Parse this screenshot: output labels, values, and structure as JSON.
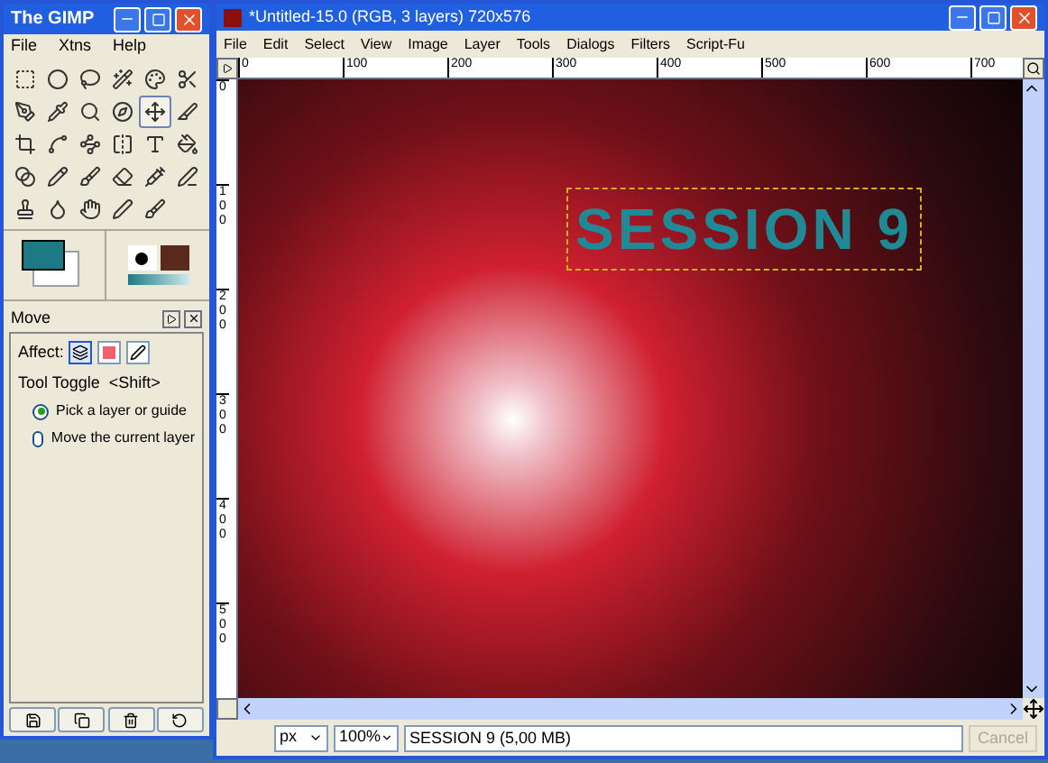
{
  "toolbox": {
    "title": "The GIMP",
    "menu": [
      "File",
      "Xtns",
      "Help"
    ],
    "tools": [
      {
        "selected": false
      },
      {
        "selected": false
      },
      {
        "selected": false
      },
      {
        "selected": false
      },
      {
        "selected": false
      },
      {
        "selected": false
      },
      {
        "selected": false
      },
      {
        "selected": false
      },
      {
        "selected": false
      },
      {
        "selected": false
      },
      {
        "selected": true
      },
      {
        "selected": false
      },
      {
        "selected": false
      },
      {
        "selected": false
      },
      {
        "selected": false
      },
      {
        "selected": false
      },
      {
        "selected": false
      },
      {
        "selected": false
      },
      {
        "selected": false
      },
      {
        "selected": false
      },
      {
        "selected": false
      },
      {
        "selected": false
      },
      {
        "selected": false
      },
      {
        "selected": false
      },
      {
        "selected": false
      },
      {
        "selected": false
      },
      {
        "selected": false
      },
      {
        "selected": false
      },
      {
        "selected": false
      }
    ],
    "options": {
      "title": "Move",
      "affect_label": "Affect:",
      "affect": [
        {
          "selected": true
        },
        {
          "selected": false
        },
        {
          "selected": false
        }
      ],
      "toggle_label": "Tool Toggle  <Shift>",
      "radios": [
        {
          "label": "Pick a layer or guide",
          "selected": true
        },
        {
          "label": "Move the current layer",
          "selected": false
        }
      ]
    }
  },
  "image_window": {
    "title": "*Untitled-15.0 (RGB, 3 layers) 720x576",
    "menu": [
      "File",
      "Edit",
      "Select",
      "View",
      "Image",
      "Layer",
      "Tools",
      "Dialogs",
      "Filters",
      "Script-Fu"
    ],
    "hruler": [
      "0",
      "100",
      "200",
      "300",
      "400",
      "500",
      "600",
      "700"
    ],
    "vruler": [
      "0",
      "100",
      "200",
      "300",
      "400",
      "500"
    ],
    "canvas_text": "SESSION 9",
    "status": {
      "unit": "px",
      "zoom": "100%",
      "message": "SESSION 9 (5,00 MB)",
      "cancel": "Cancel",
      "cancel_disabled": true
    }
  }
}
